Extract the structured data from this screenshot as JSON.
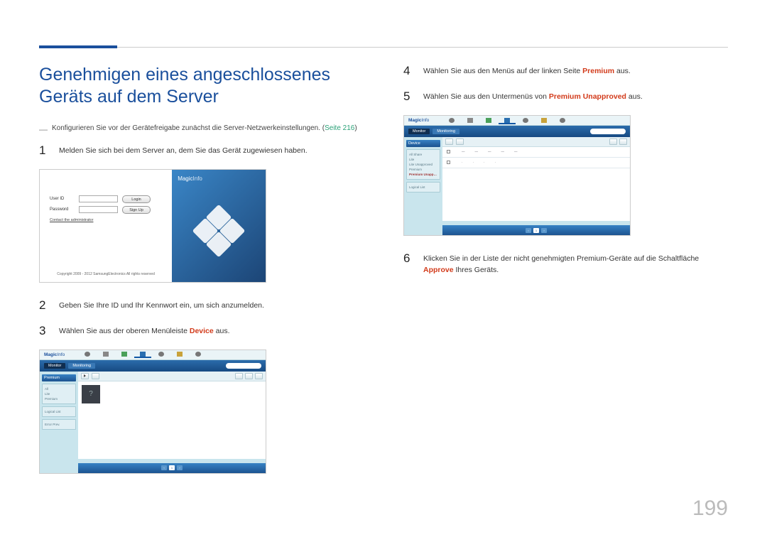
{
  "page_number": "199",
  "heading": "Genehmigen eines angeschlossenes Geräts auf dem Server",
  "note": {
    "dash": "―",
    "text": "Konfigurieren Sie vor der Gerätefreigabe zunächst die Server-Netzwerkeinstellungen. (",
    "link": "Seite 216",
    "text_after": ")"
  },
  "steps": {
    "s1": {
      "num": "1",
      "text": "Melden Sie sich bei dem Server an, dem Sie das Gerät zugewiesen haben."
    },
    "s2": {
      "num": "2",
      "text": "Geben Sie Ihre ID und Ihr Kennwort ein, um sich anzumelden."
    },
    "s3": {
      "num": "3",
      "pre": "Wählen Sie aus der oberen Menüleiste ",
      "bold": "Device",
      "post": " aus."
    },
    "s4": {
      "num": "4",
      "pre": "Wählen Sie aus den Menüs auf der linken Seite ",
      "bold": "Premium",
      "post": " aus."
    },
    "s5": {
      "num": "5",
      "pre": "Wählen Sie aus den Untermenüs von ",
      "bold": "Premium Unapproved",
      "post": " aus."
    },
    "s6": {
      "num": "6",
      "pre": "Klicken Sie in der Liste der nicht genehmigten Premium-Geräte auf die Schaltfläche ",
      "bold": "Approve",
      "post": " Ihres Geräts."
    }
  },
  "login_shot": {
    "user_id_label": "User ID",
    "password_label": "Password",
    "login_btn": "Login",
    "signup_btn": "Sign Up",
    "contact": "Contact the administrator",
    "copyright": "Copyright 2009 - 2012 SamsungElectronics All rights reserved",
    "brand_left": "Magic",
    "brand_right": "Info"
  },
  "app": {
    "brand_left": "Magic",
    "brand_right": "Info",
    "subtabs": {
      "monitor": "Monitor",
      "monitoring": "Monitoring"
    },
    "side_head_premium": "Premium",
    "side_items_shell2": [
      "All",
      "Lite",
      "Premium"
    ],
    "side_lower2": [
      "Logical List",
      "Error Prev."
    ],
    "side_head_device": "Device",
    "side_items_shell3": [
      "All Share",
      "Lite",
      "Lite Unapproved",
      "Premium",
      "Premium Unapproved"
    ],
    "side_lower3": [
      "Logical List"
    ],
    "pager_label": "1"
  }
}
